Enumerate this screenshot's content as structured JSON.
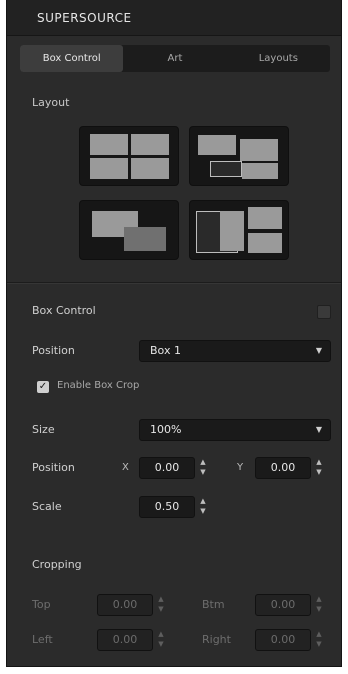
{
  "title": "SUPERSOURCE",
  "tabs": [
    "Box Control",
    "Art",
    "Layouts"
  ],
  "layout_section_label": "Layout",
  "layout_presets": [
    "2x2 Grid",
    "3 Box Stack",
    "Overlapping Boxes",
    "Split Boxes"
  ],
  "box_control": {
    "label": "Box Control",
    "enabled": false
  },
  "position_source": {
    "label": "Position",
    "value": "Box 1"
  },
  "crop_checkbox": {
    "label": "Enable Box Crop",
    "checked": true
  },
  "size_select": {
    "label": "Size",
    "value": "100%"
  },
  "position_fields": {
    "label": "Position",
    "x_axis": "X",
    "x_value": "0.00",
    "y_axis": "Y",
    "y_value": "0.00"
  },
  "scale_field": {
    "label": "Scale",
    "value": "0.50"
  },
  "crop_section": {
    "label": "Cropping",
    "top_label": "Top",
    "top_value": "0.00",
    "bottom_label": "Btm",
    "bottom_value": "0.00",
    "left_label": "Left",
    "left_value": "0.00",
    "right_label": "Right",
    "right_value": "0.00"
  },
  "colors": {
    "panel_bg": "#2b2b2b",
    "field_bg": "#1a1a1a",
    "preset_fill": "#9a9a9a"
  }
}
